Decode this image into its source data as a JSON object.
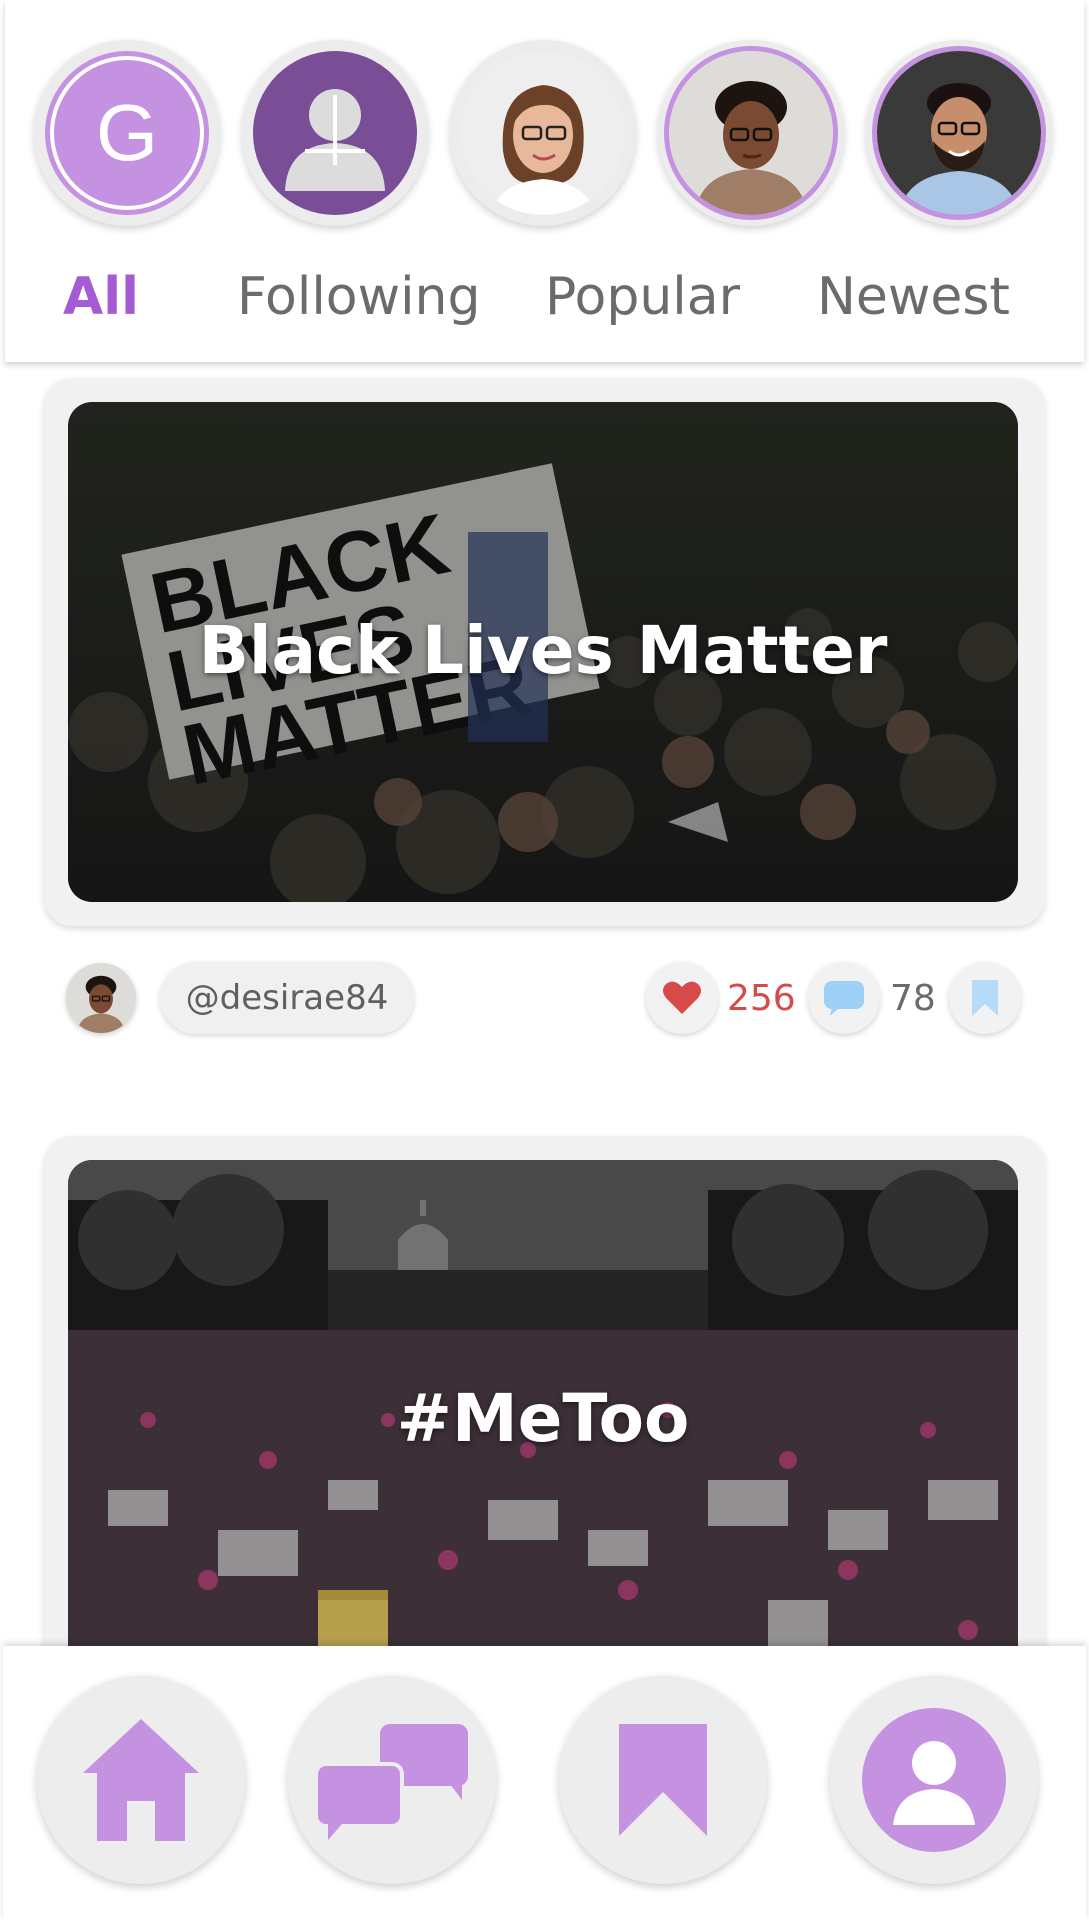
{
  "stories": {
    "items": [
      {
        "label": "G",
        "type": "letter"
      },
      {
        "type": "add-user"
      },
      {
        "type": "photo",
        "person": "woman-glasses-brown-hair"
      },
      {
        "type": "photo",
        "person": "woman-glasses-turtleneck",
        "ring": true
      },
      {
        "type": "photo",
        "person": "man-glasses-beard",
        "ring": true
      }
    ]
  },
  "tabs": [
    {
      "label": "All",
      "active": true
    },
    {
      "label": "Following",
      "active": false
    },
    {
      "label": "Popular",
      "active": false
    },
    {
      "label": "Newest",
      "active": false
    }
  ],
  "posts": [
    {
      "title": "Black Lives Matter",
      "author": "@desirae84",
      "likes": "256",
      "comments": "78"
    },
    {
      "title": "#MeToo"
    }
  ],
  "colors": {
    "accent": "#c591e1",
    "accent_dark": "#a45bd3",
    "add_user_bg": "#7a4d97",
    "like_red": "#d84a4a",
    "comment_blue": "#9fd0f5",
    "bookmark_blue": "#b6dbf8"
  },
  "bottom_nav": [
    {
      "icon": "home-icon"
    },
    {
      "icon": "chat-icon"
    },
    {
      "icon": "bookmark-icon"
    },
    {
      "icon": "profile-icon"
    }
  ]
}
